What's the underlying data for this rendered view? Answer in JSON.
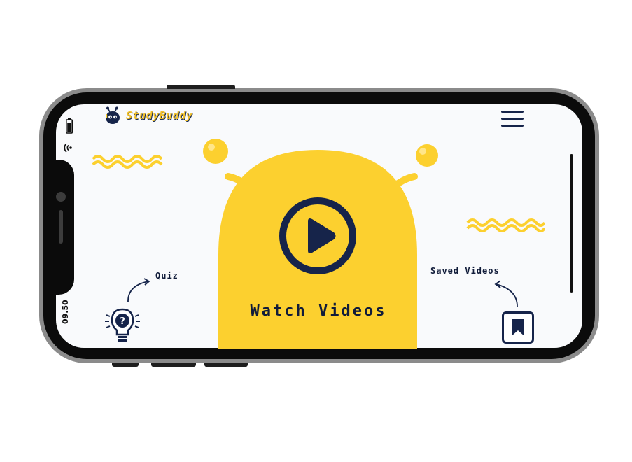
{
  "app": {
    "brand": "StudyBuddy"
  },
  "status_bar": {
    "time": "09.50"
  },
  "main": {
    "watch_label": "Watch Videos"
  },
  "shortcuts": {
    "quiz_label": "Quiz",
    "saved_label": "Saved Videos"
  },
  "colors": {
    "accent": "#fcd02f",
    "navy": "#16244a",
    "background": "#f9fafc",
    "frame": "#8b8b8b"
  },
  "icons": [
    "battery-icon",
    "wifi-icon",
    "logo-bee-icon",
    "menu-icon",
    "play-icon",
    "lightbulb-question-icon",
    "bookmark-icon",
    "curved-arrow-icon"
  ]
}
